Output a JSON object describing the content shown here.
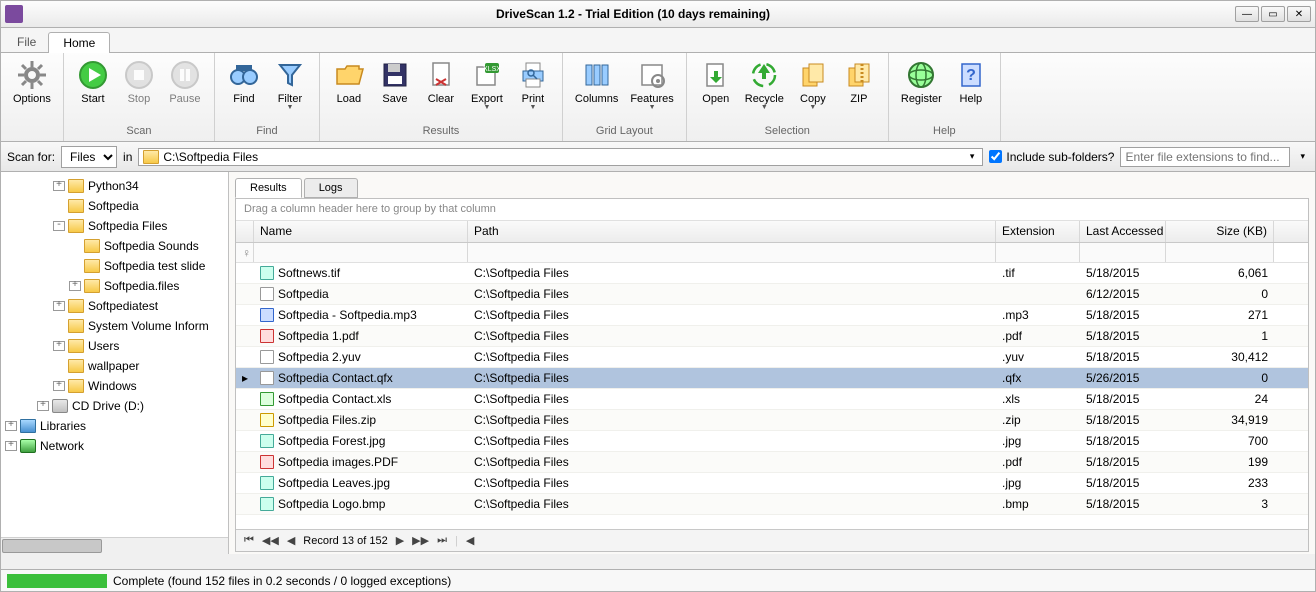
{
  "title": "DriveScan 1.2 - Trial Edition (10 days remaining)",
  "menu": {
    "file": "File",
    "home": "Home"
  },
  "ribbon": {
    "groups": [
      {
        "label": "",
        "buttons": [
          {
            "label": "Options",
            "icon": "gear"
          }
        ]
      },
      {
        "label": "Scan",
        "buttons": [
          {
            "label": "Start",
            "icon": "play"
          },
          {
            "label": "Stop",
            "icon": "stop",
            "disabled": true
          },
          {
            "label": "Pause",
            "icon": "pause",
            "disabled": true
          }
        ]
      },
      {
        "label": "Find",
        "buttons": [
          {
            "label": "Find",
            "icon": "binoculars"
          },
          {
            "label": "Filter",
            "icon": "funnel",
            "dropdown": true
          }
        ]
      },
      {
        "label": "Results",
        "buttons": [
          {
            "label": "Load",
            "icon": "folder-open"
          },
          {
            "label": "Save",
            "icon": "floppy"
          },
          {
            "label": "Clear",
            "icon": "page-x"
          },
          {
            "label": "Export",
            "icon": "export",
            "dropdown": true
          },
          {
            "label": "Print",
            "icon": "print",
            "dropdown": true
          }
        ]
      },
      {
        "label": "Grid Layout",
        "buttons": [
          {
            "label": "Columns",
            "icon": "columns"
          },
          {
            "label": "Features",
            "icon": "features",
            "dropdown": true
          }
        ]
      },
      {
        "label": "Selection",
        "buttons": [
          {
            "label": "Open",
            "icon": "open"
          },
          {
            "label": "Recycle",
            "icon": "recycle",
            "dropdown": true
          },
          {
            "label": "Copy",
            "icon": "copy",
            "dropdown": true
          },
          {
            "label": "ZIP",
            "icon": "zip"
          }
        ]
      },
      {
        "label": "Help",
        "buttons": [
          {
            "label": "Register",
            "icon": "globe"
          },
          {
            "label": "Help",
            "icon": "help"
          }
        ]
      }
    ]
  },
  "scanbar": {
    "label": "Scan for:",
    "type": "Files",
    "in": "in",
    "path": "C:\\Softpedia Files",
    "include_sub": "Include sub-folders?",
    "include_checked": true,
    "ext_placeholder": "Enter file extensions to find..."
  },
  "tree": [
    {
      "indent": 3,
      "expand": "+",
      "icon": "folder",
      "label": "Python34"
    },
    {
      "indent": 3,
      "expand": "",
      "icon": "folder",
      "label": "Softpedia"
    },
    {
      "indent": 3,
      "expand": "-",
      "icon": "folder",
      "label": "Softpedia Files"
    },
    {
      "indent": 4,
      "expand": "",
      "icon": "folder",
      "label": "Softpedia Sounds"
    },
    {
      "indent": 4,
      "expand": "",
      "icon": "folder",
      "label": "Softpedia test slide"
    },
    {
      "indent": 4,
      "expand": "+",
      "icon": "folder",
      "label": "Softpedia.files"
    },
    {
      "indent": 3,
      "expand": "+",
      "icon": "folder",
      "label": "Softpediatest"
    },
    {
      "indent": 3,
      "expand": "",
      "icon": "folder",
      "label": "System Volume Inform"
    },
    {
      "indent": 3,
      "expand": "+",
      "icon": "folder",
      "label": "Users"
    },
    {
      "indent": 3,
      "expand": "",
      "icon": "folder",
      "label": "wallpaper"
    },
    {
      "indent": 3,
      "expand": "+",
      "icon": "folder",
      "label": "Windows"
    },
    {
      "indent": 2,
      "expand": "+",
      "icon": "drive",
      "label": "CD Drive (D:)"
    },
    {
      "indent": 0,
      "expand": "+",
      "icon": "lib",
      "label": "Libraries"
    },
    {
      "indent": 0,
      "expand": "+",
      "icon": "net",
      "label": "Network"
    }
  ],
  "tabs": {
    "results": "Results",
    "logs": "Logs"
  },
  "group_hint": "Drag a column header here to group by that column",
  "columns": {
    "name": "Name",
    "path": "Path",
    "ext": "Extension",
    "date": "Last Accessed",
    "size": "Size (KB)"
  },
  "rows": [
    {
      "ico": "img",
      "name": "Softnews.tif",
      "path": "C:\\Softpedia Files",
      "ext": ".tif",
      "date": "5/18/2015",
      "size": "6,061"
    },
    {
      "ico": "doc",
      "name": "Softpedia",
      "path": "C:\\Softpedia Files",
      "ext": "",
      "date": "6/12/2015",
      "size": "0"
    },
    {
      "ico": "mp3",
      "name": "Softpedia - Softpedia.mp3",
      "path": "C:\\Softpedia Files",
      "ext": ".mp3",
      "date": "5/18/2015",
      "size": "271"
    },
    {
      "ico": "pdf",
      "name": "Softpedia 1.pdf",
      "path": "C:\\Softpedia Files",
      "ext": ".pdf",
      "date": "5/18/2015",
      "size": "1"
    },
    {
      "ico": "doc",
      "name": "Softpedia 2.yuv",
      "path": "C:\\Softpedia Files",
      "ext": ".yuv",
      "date": "5/18/2015",
      "size": "30,412"
    },
    {
      "ico": "doc",
      "name": "Softpedia Contact.qfx",
      "path": "C:\\Softpedia Files",
      "ext": ".qfx",
      "date": "5/26/2015",
      "size": "0",
      "selected": true
    },
    {
      "ico": "xls",
      "name": "Softpedia Contact.xls",
      "path": "C:\\Softpedia Files",
      "ext": ".xls",
      "date": "5/18/2015",
      "size": "24"
    },
    {
      "ico": "zip",
      "name": "Softpedia Files.zip",
      "path": "C:\\Softpedia Files",
      "ext": ".zip",
      "date": "5/18/2015",
      "size": "34,919"
    },
    {
      "ico": "img",
      "name": "Softpedia Forest.jpg",
      "path": "C:\\Softpedia Files",
      "ext": ".jpg",
      "date": "5/18/2015",
      "size": "700"
    },
    {
      "ico": "pdf",
      "name": "Softpedia images.PDF",
      "path": "C:\\Softpedia Files",
      "ext": ".pdf",
      "date": "5/18/2015",
      "size": "199"
    },
    {
      "ico": "img",
      "name": "Softpedia Leaves.jpg",
      "path": "C:\\Softpedia Files",
      "ext": ".jpg",
      "date": "5/18/2015",
      "size": "233"
    },
    {
      "ico": "img",
      "name": "Softpedia Logo.bmp",
      "path": "C:\\Softpedia Files",
      "ext": ".bmp",
      "date": "5/18/2015",
      "size": "3"
    }
  ],
  "nav": {
    "record": "Record 13 of 152"
  },
  "status": "Complete (found 152 files in 0.2 seconds / 0 logged exceptions)"
}
